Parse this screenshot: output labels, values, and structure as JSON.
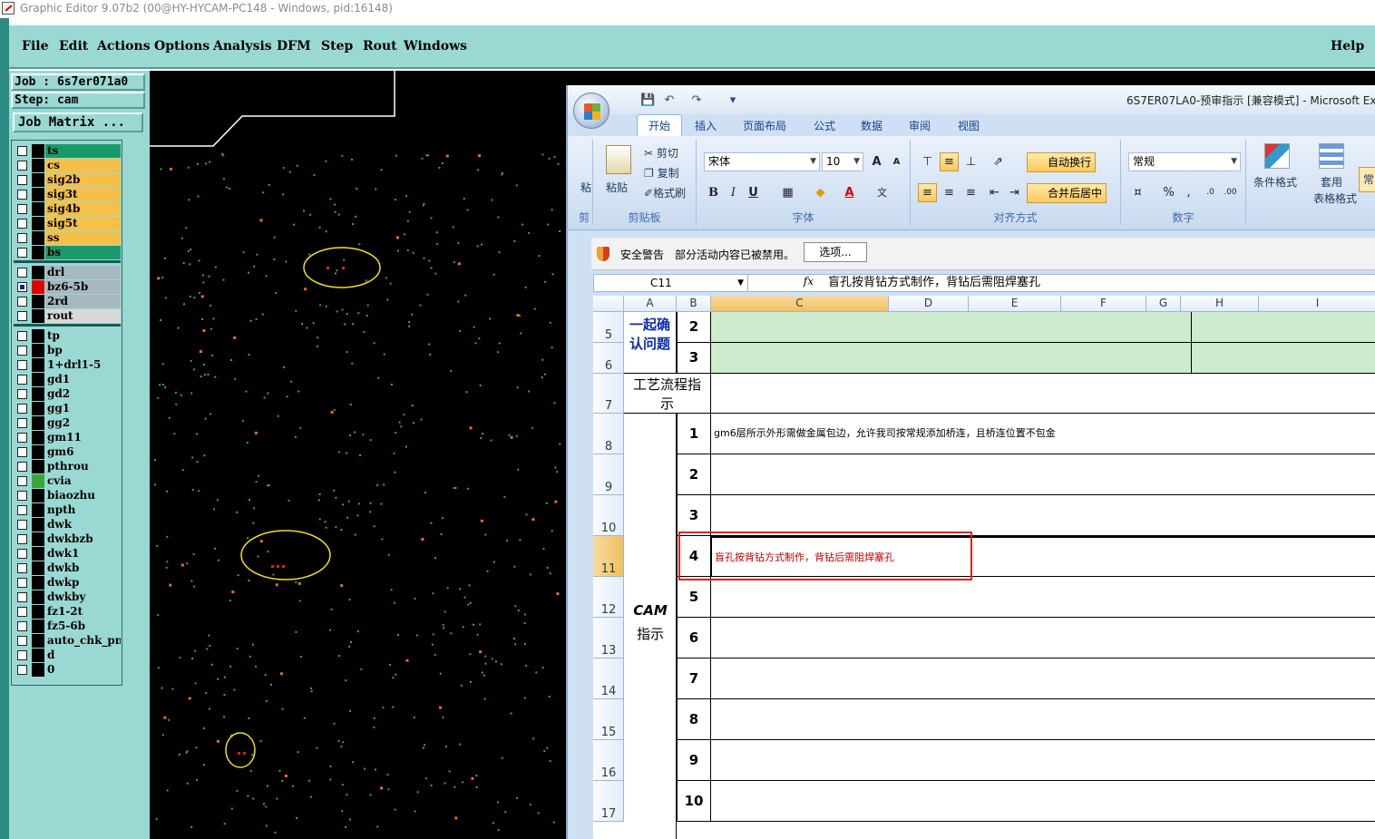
{
  "ge": {
    "title": "Graphic Editor 9.07b2 (00@HY-HYCAM-PC148 - Windows, pid:16148)",
    "menu": [
      "File",
      "Edit",
      "Actions",
      "Options",
      "Analysis",
      "DFM",
      "Step",
      "Rout",
      "Windows"
    ],
    "help": "Help",
    "job": "Job : 6s7er071a0",
    "step": "Step: cam",
    "job_matrix": "Job Matrix ...",
    "layers_group1": [
      {
        "name": "ts",
        "color": "#1a9a6a"
      },
      {
        "name": "cs",
        "color": "#f5c04a"
      },
      {
        "name": "sig2b",
        "color": "#f5c04a"
      },
      {
        "name": "sig3t",
        "color": "#f5c04a"
      },
      {
        "name": "sig4b",
        "color": "#f5c04a"
      },
      {
        "name": "sig5t",
        "color": "#f5c04a"
      },
      {
        "name": "ss",
        "color": "#f5c04a"
      },
      {
        "name": "bs",
        "color": "#1a9a6a"
      }
    ],
    "layers_group2": [
      {
        "name": "drl",
        "color": "#a8b8c0"
      },
      {
        "name": "bz6-5b",
        "color": "#a8b8c0",
        "active": true
      },
      {
        "name": "2rd",
        "color": "#a8b8c0"
      },
      {
        "name": "rout",
        "color": "#d8d8d8"
      }
    ],
    "layers_group3": [
      {
        "name": "tp"
      },
      {
        "name": "bp"
      },
      {
        "name": "1+drl1-5"
      },
      {
        "name": "gd1"
      },
      {
        "name": "gd2"
      },
      {
        "name": "gg1"
      },
      {
        "name": "gg2"
      },
      {
        "name": "gm11"
      },
      {
        "name": "gm6"
      },
      {
        "name": "pthrou"
      },
      {
        "name": "cvia",
        "swatch": "#3aa53a"
      },
      {
        "name": "biaozhu"
      },
      {
        "name": "npth"
      },
      {
        "name": "dwk"
      },
      {
        "name": "dwkbzb"
      },
      {
        "name": "dwk1"
      },
      {
        "name": "dwkb"
      },
      {
        "name": "dwkp"
      },
      {
        "name": "dwkby"
      },
      {
        "name": "fz1-2t"
      },
      {
        "name": "fz5-6b"
      },
      {
        "name": "auto_chk_pn."
      },
      {
        "name": "d"
      },
      {
        "name": "0"
      }
    ],
    "colors": {
      "panel": "#9ad9d3",
      "group3": "#9ad9d3",
      "active_swatch": "#e00000"
    }
  },
  "xl": {
    "title": "6S7ER07LA0-预审指示  [兼容模式] - Microsoft Ex",
    "tabs": [
      "开始",
      "插入",
      "页面布局",
      "公式",
      "数据",
      "审阅",
      "视图"
    ],
    "clipboard": {
      "paste": "粘贴",
      "cut": "剪切",
      "copy": "复制",
      "painter": "格式刷",
      "label": "剪贴板",
      "partial": "粘",
      "partial2": "剪"
    },
    "font": {
      "name": "宋体",
      "size": "10",
      "label": "字体",
      "bold": "B",
      "italic": "I",
      "underline": "U"
    },
    "align": {
      "wrap": "自动换行",
      "merge": "合并后居中",
      "label": "对齐方式"
    },
    "number": {
      "format": "常规",
      "label": "数字",
      "percent": "%",
      "comma": ","
    },
    "styles": {
      "cond": "条件格式",
      "table1": "套用",
      "table2": "表格格式",
      "partial": "常"
    },
    "security": {
      "label": "安全警告",
      "message": "部分活动内容已被禁用。",
      "options": "选项..."
    },
    "name_box": "C11",
    "fx": "fx",
    "formula": "盲孔按背钻方式制作，背钻后需阻焊塞孔",
    "columns": [
      "A",
      "B",
      "C",
      "D",
      "E",
      "F",
      "G",
      "H",
      "I"
    ],
    "rows": [
      "5",
      "6",
      "7",
      "8",
      "9",
      "10",
      "11",
      "12",
      "13",
      "14",
      "15",
      "16",
      "17"
    ],
    "confirm_label": "一起确认问题",
    "confirm_numbers": [
      "2",
      "3"
    ],
    "process_label": "工艺流程指示",
    "cam_label": "CAM",
    "cam_label2": "指示",
    "cam_numbers": [
      "1",
      "2",
      "3",
      "4",
      "5",
      "6",
      "7",
      "8",
      "9",
      "10"
    ],
    "cam_row1_text": "gm6层所示外形需做金属包边，允许我司按常规添加桥连，且桥连位置不包金",
    "cam_row4_text": "盲孔按背钻方式制作，背钻后需阻焊塞孔",
    "colors": {
      "confirm_bg": "#cdeccd",
      "highlight": "#e02020",
      "row4_text": "#c00000",
      "confirm_text": "#0a2bb0"
    }
  }
}
